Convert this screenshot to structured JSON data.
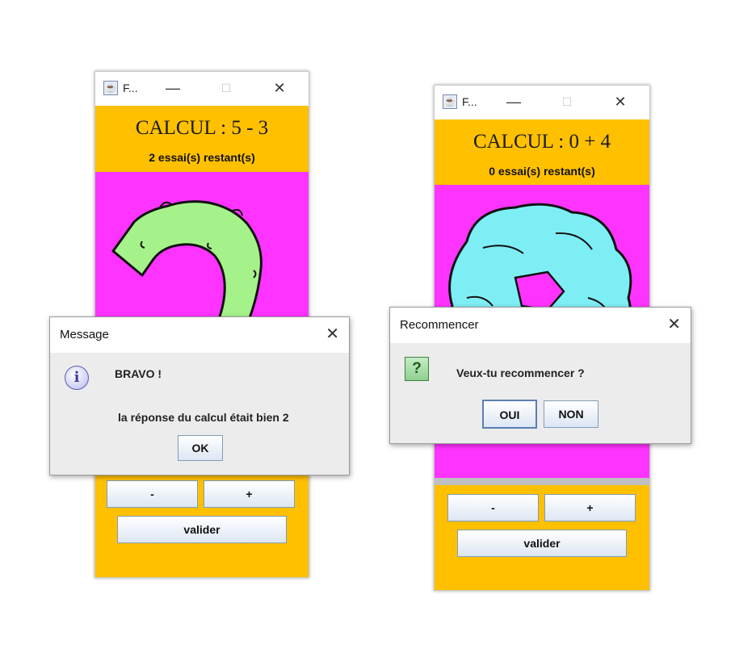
{
  "left_window": {
    "title": "F...",
    "calc_label": "CALCUL : 5 - 3",
    "tries_label": "2  essai(s) restant(s)",
    "minus_label": "-",
    "plus_label": "+",
    "validate_label": "valider",
    "colors": {
      "header": "#ffc000",
      "image_bg": "#ff33ff",
      "digit_fill": "#a6f28a"
    },
    "image_icon": "digit-2-drawing"
  },
  "right_window": {
    "title": "F...",
    "calc_label": "CALCUL : 0 + 4",
    "tries_label": "0  essai(s) restant(s)",
    "minus_label": "-",
    "plus_label": "+",
    "validate_label": "valider",
    "colors": {
      "header": "#ffc000",
      "image_bg": "#ff33ff",
      "digit_fill": "#7eeef5"
    },
    "image_icon": "digit-0-drawing"
  },
  "window_controls": {
    "minimize": "—",
    "maximize": "☐",
    "close": "✕"
  },
  "message_dialog": {
    "title": "Message",
    "close": "✕",
    "icon": "info-icon",
    "headline": "BRAVO !",
    "detail": "la réponse du calcul était bien   2",
    "ok_label": "OK"
  },
  "restart_dialog": {
    "title": "Recommencer",
    "close": "✕",
    "icon": "question-icon",
    "question": "Veux-tu recommencer ?",
    "yes_label": "OUI",
    "no_label": "NON"
  }
}
